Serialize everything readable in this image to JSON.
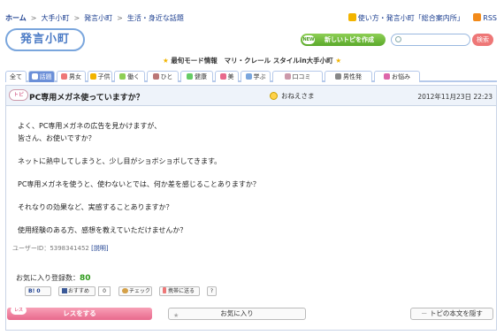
{
  "breadcrumb": {
    "home": "ホーム",
    "sep": ">",
    "items": [
      "大手小町",
      "発言小町",
      "生活・身近な話題"
    ]
  },
  "toplinks": {
    "guide": "使い方・発言小町「総合案内所」",
    "rss": "RSS"
  },
  "logo": {
    "text": "発言小町"
  },
  "header": {
    "new_badge": "NEW",
    "new_topic": "新しいトピを作成",
    "search_placeholder": "",
    "search_button": "検索"
  },
  "promo": {
    "label": "最旬モード情報",
    "text": "マリ・クレール スタイルin大手小町"
  },
  "categories": [
    {
      "label": "全て",
      "icon_color": ""
    },
    {
      "label": "話題",
      "icon_color": "#6b8fd8",
      "active": true
    },
    {
      "label": "男女",
      "icon_color": "#e77"
    },
    {
      "label": "子供",
      "icon_color": "#f2b400"
    },
    {
      "label": "働く",
      "icon_color": "#8ecf55"
    },
    {
      "label": "ひと",
      "icon_color": "#b77"
    },
    {
      "label": "健康",
      "icon_color": "#6c6"
    },
    {
      "label": "美",
      "icon_color": "#e8698c"
    },
    {
      "label": "学ぶ",
      "icon_color": "#7aa6dd"
    },
    {
      "label": "口コミ",
      "icon_color": "#c9a"
    },
    {
      "label": "男性発",
      "icon_color": "#888"
    },
    {
      "label": "お悩み",
      "icon_color": "#d6a"
    }
  ],
  "topic": {
    "badge": "トピ",
    "title": "PC専用メガネ使っていますか？",
    "author": "おねえさま",
    "date": "2012年11月23日 22:23",
    "lines": [
      "よく、PC専用メガネの広告を見かけますが、",
      "皆さん、お使いですか？",
      "ネットに熱中してしまうと、少し目がショボショボしてきます。",
      "PC専用メガネを使うと、使わないとでは、何か差を感じることありますか？",
      "それなりの効果など、実感することありますか？",
      "使用経験のある方、感想を教えていただけませんか？"
    ],
    "user_id": "ユーザーID：5398341452",
    "explain": "[説明]",
    "fav_label": "お気に入り登録数：",
    "fav_count": "80"
  },
  "share": {
    "hatena": "B! 0",
    "fb": "おすすめ",
    "fb_count": "0",
    "check": "チェック",
    "mobile": "携帯に送る",
    "help": "?"
  },
  "actions": {
    "res_tag": "レス",
    "res": "レスをする",
    "fav": "お気に入り",
    "hide": "トピの本文を隠す"
  },
  "colors": {
    "accent": "#6b8fd8",
    "res_pink": "#e8698c",
    "fav_green": "#2d9a1a"
  }
}
